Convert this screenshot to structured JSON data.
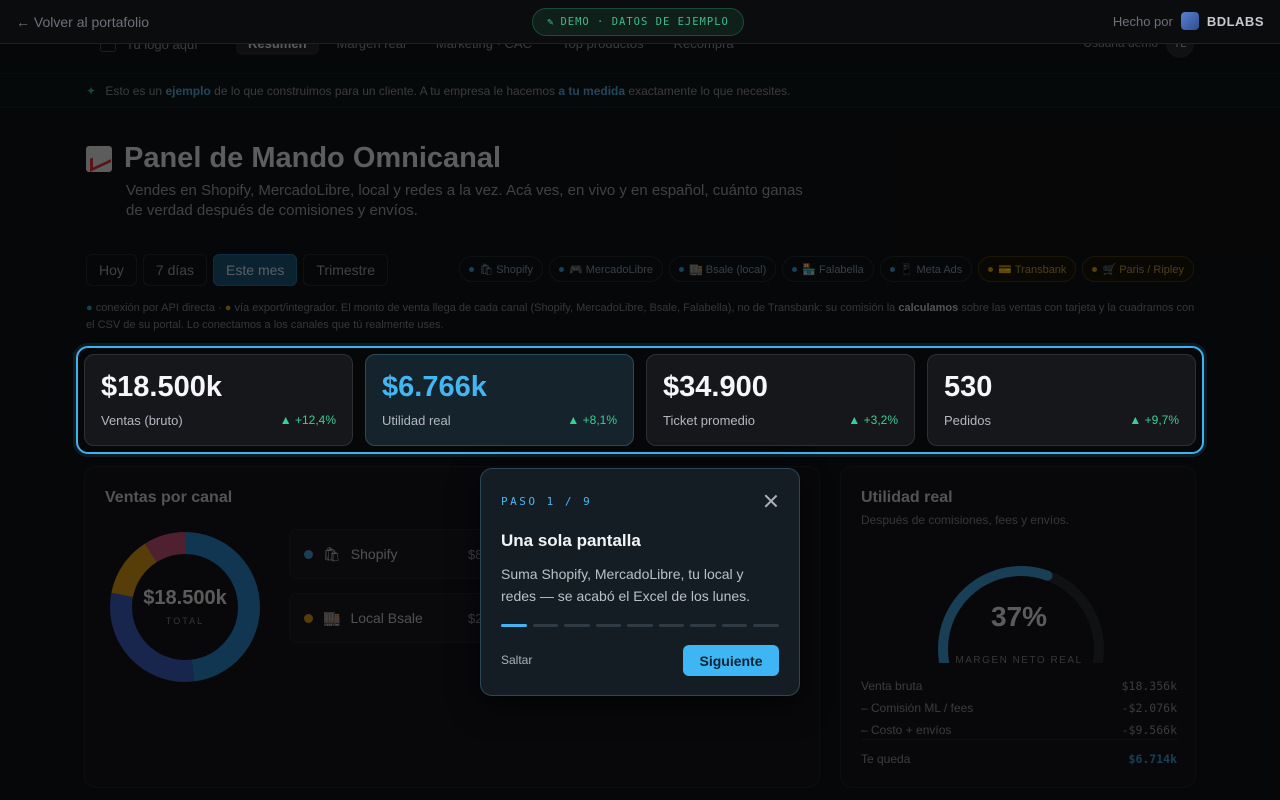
{
  "topbar": {
    "back_label": "← Volver al portafolio",
    "demo_badge": "DEMO · DATOS DE EJEMPLO",
    "made_by_prefix": "Hecho por",
    "brand": "BDLABS"
  },
  "app": {
    "logo_placeholder": "Tu logo aquí",
    "nav": [
      "Resumen",
      "Margen real",
      "Marketing · CAC",
      "Top productos",
      "Recompra"
    ],
    "active_nav": "Resumen",
    "user_label": "Usuaria demo",
    "user_initials": "TL"
  },
  "notice": {
    "icon": "sparkle-icon",
    "text_1": "Esto es un",
    "highlight_1": "ejemplo",
    "text_2": "de lo que construimos para un cliente. A tu empresa le hacemos",
    "highlight_2": "a tu medida",
    "text_3": "exactamente lo que necesites."
  },
  "header": {
    "title": "Panel de Mando Omnicanal",
    "subtitle": "Vendes en Shopify, MercadoLibre, local y redes a la vez. Acá ves, en vivo y en español, cuánto ganas de verdad después de comisiones y envíos."
  },
  "periods": [
    "Hoy",
    "7 días",
    "Este mes",
    "Trimestre"
  ],
  "active_period": "Este mes",
  "channels": [
    {
      "label": "🛍 Shopify",
      "kind": "api"
    },
    {
      "label": "🎮 MercadoLibre",
      "kind": "api"
    },
    {
      "label": "🏬 Bsale (local)",
      "kind": "api"
    },
    {
      "label": "🏪 Falabella",
      "kind": "api"
    },
    {
      "label": "📱 Meta Ads",
      "kind": "api"
    },
    {
      "label": "💳 Transbank",
      "kind": "export"
    },
    {
      "label": "🛒 Paris / Ripley",
      "kind": "export"
    }
  ],
  "legend_note": {
    "part_1": "conexión por API directa ·",
    "part_2": "vía export/integrador. El monto de venta llega de cada canal (Shopify, MercadoLibre, Bsale, Falabella), no de Transbank: su comisión la",
    "bold": "calculamos",
    "part_3": "sobre las ventas con tarjeta y la cuadramos con el CSV de su portal. Lo conectamos a los canales que tú realmente uses."
  },
  "kpis": [
    {
      "value": "$18.500k",
      "label": "Ventas (bruto)",
      "delta": "▲ +12,4%"
    },
    {
      "value": "$6.766k",
      "label": "Utilidad real",
      "delta": "▲ +8,1%"
    },
    {
      "value": "$34.900",
      "label": "Ticket promedio",
      "delta": "▲ +3,2%"
    },
    {
      "value": "530",
      "label": "Pedidos",
      "delta": "▲ +9,7%"
    }
  ],
  "sales_by_channel": {
    "title": "Ventas por canal",
    "center_value": "$18.500k",
    "center_label": "TOTAL",
    "rows": [
      {
        "name": "Shopify",
        "icon": "🛍",
        "value": "$8",
        "color": "#4aa3e0"
      },
      {
        "name": "Local Bsale",
        "icon": "🏬",
        "value": "$2",
        "color": "#e5a21a"
      }
    ],
    "slices": [
      {
        "share": 0.48,
        "color": "#2f8fd8"
      },
      {
        "share": 0.3,
        "color": "#3f63c9"
      },
      {
        "share": 0.13,
        "color": "#e5a21a"
      },
      {
        "share": 0.09,
        "color": "#d0557f"
      }
    ]
  },
  "profit": {
    "title": "Utilidad real",
    "subtitle": "Después de comisiones, fees y envíos.",
    "percent": "37%",
    "percent_value": 37,
    "gauge_label": "MARGEN NETO REAL",
    "breakdown": [
      {
        "label": "Venta bruta",
        "value": "$18.356k"
      },
      {
        "label": "– Comisión ML / fees",
        "value": "-$2.076k"
      },
      {
        "label": "– Costo + envíos",
        "value": "-$9.566k"
      }
    ],
    "total_label": "Te queda",
    "total_value": "$6.714k"
  },
  "tour": {
    "step": "PASO 1 / 9",
    "title": "Una sola pantalla",
    "body": "Suma Shopify, MercadoLibre, tu local y redes — se acabó el Excel de los lunes.",
    "current": 1,
    "total": 9,
    "skip": "Saltar",
    "next": "Siguiente"
  }
}
